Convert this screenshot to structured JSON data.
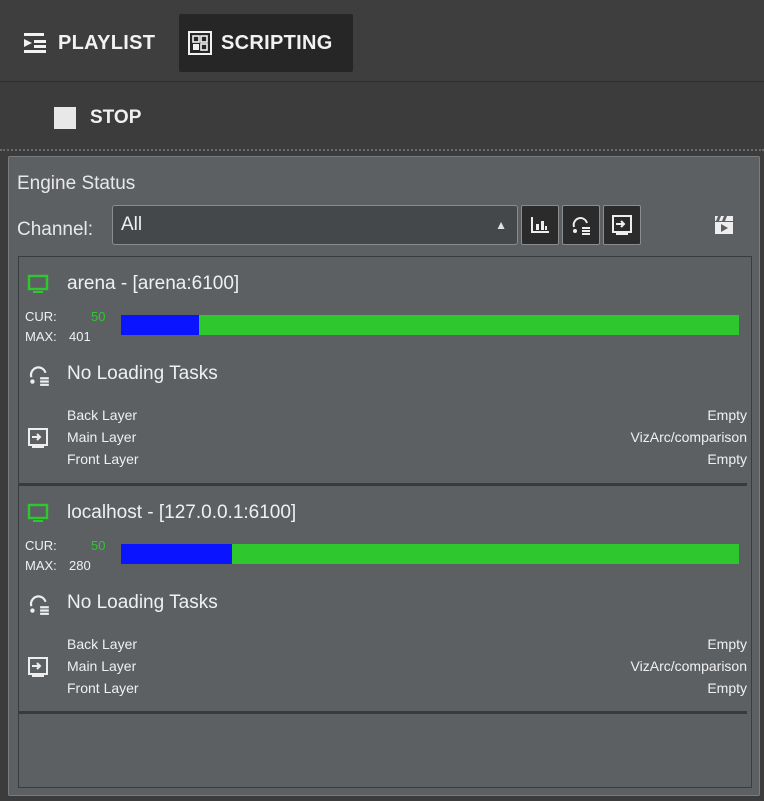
{
  "tabs": [
    {
      "label": "PLAYLIST",
      "icon": "playlist-icon",
      "active": false
    },
    {
      "label": "SCRIPTING",
      "icon": "scripting-icon",
      "active": true
    }
  ],
  "toolbar": {
    "stop_label": "STOP"
  },
  "engine_status": {
    "title": "Engine Status",
    "channel_label": "Channel:",
    "channel_value": "All",
    "buttons": [
      "bar-chart-icon",
      "loading-tasks-icon",
      "layers-icon",
      "clapperboard-icon"
    ],
    "engines": [
      {
        "name": "arena - [arena:6100]",
        "cur_label": "CUR:",
        "cur_value": "50",
        "max_label": "MAX:",
        "max_value": "401",
        "loading_text": "No Loading Tasks",
        "layers": [
          {
            "name": "Back Layer",
            "value": "Empty"
          },
          {
            "name": "Main Layer",
            "value": "VizArc/comparison"
          },
          {
            "name": "Front Layer",
            "value": "Empty"
          }
        ]
      },
      {
        "name": "localhost - [127.0.0.1:6100]",
        "cur_label": "CUR:",
        "cur_value": "50",
        "max_label": "MAX:",
        "max_value": "280",
        "loading_text": "No Loading Tasks",
        "layers": [
          {
            "name": "Back Layer",
            "value": "Empty"
          },
          {
            "name": "Main Layer",
            "value": "VizArc/comparison"
          },
          {
            "name": "Front Layer",
            "value": "Empty"
          }
        ]
      }
    ]
  },
  "colors": {
    "status_green": "#2ec72e",
    "usage_blue": "#0a14ff",
    "panel_bg": "#5d6063"
  }
}
